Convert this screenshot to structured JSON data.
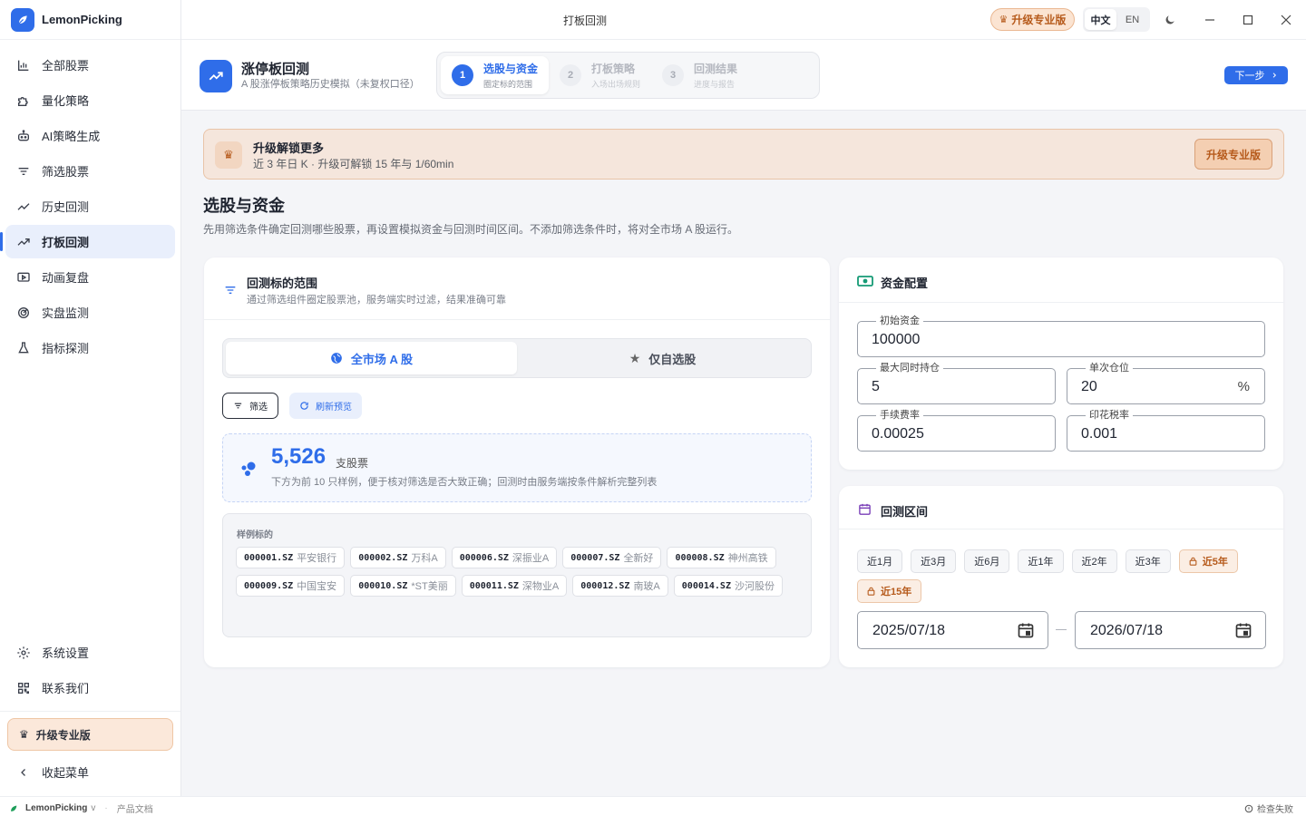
{
  "app": {
    "name": "LemonPicking",
    "window_title": "打板回测"
  },
  "sidebar": {
    "items": [
      {
        "label": "全部股票",
        "icon": "bar-chart-icon"
      },
      {
        "label": "量化策略",
        "icon": "puzzle-icon"
      },
      {
        "label": "AI策略生成",
        "icon": "robot-icon"
      },
      {
        "label": "筛选股票",
        "icon": "filter-icon"
      },
      {
        "label": "历史回测",
        "icon": "trend-icon"
      },
      {
        "label": "打板回测",
        "icon": "trend-up-icon",
        "active": true
      },
      {
        "label": "动画复盘",
        "icon": "play-screen-icon"
      },
      {
        "label": "实盘监测",
        "icon": "radar-icon"
      },
      {
        "label": "指标探测",
        "icon": "flask-icon"
      }
    ],
    "bottom_items": [
      {
        "label": "系统设置",
        "icon": "gear-icon"
      },
      {
        "label": "联系我们",
        "icon": "qr-icon"
      }
    ],
    "upgrade_label": "升级专业版",
    "collapse_label": "收起菜单"
  },
  "topbar": {
    "upgrade_label": "升级专业版",
    "lang_zh": "中文",
    "lang_en": "EN"
  },
  "header": {
    "title": "涨停板回测",
    "subtitle": "A 股涨停板策略历史模拟（未复权口径）",
    "steps": [
      {
        "num": "1",
        "title": "选股与资金",
        "sub": "圈定标的范围",
        "active": true
      },
      {
        "num": "2",
        "title": "打板策略",
        "sub": "入场出场规则",
        "active": false
      },
      {
        "num": "3",
        "title": "回测结果",
        "sub": "进度与报告",
        "active": false
      }
    ],
    "next_label": "下一步"
  },
  "banner": {
    "title": "升级解锁更多",
    "subtitle": "近 3 年日 K · 升级可解锁 15 年与 1/60min",
    "button": "升级专业版"
  },
  "section": {
    "title": "选股与资金",
    "desc": "先用筛选条件确定回测哪些股票，再设置模拟资金与回测时间区间。不添加筛选条件时，将对全市场 A 股运行。"
  },
  "scope": {
    "title": "回测标的范围",
    "subtitle": "通过筛选组件圈定股票池，服务端实时过滤，结果准确可靠",
    "tab_all": "全市场 A 股",
    "tab_watch": "仅自选股",
    "filter_label": "筛选",
    "refresh_label": "刷新预览",
    "count": "5,526",
    "count_unit": "支股票",
    "count_desc": "下方为前 10 只样例，便于核对筛选是否大致正确；回测时由服务端按条件解析完整列表",
    "sample_label": "样例标的",
    "samples": [
      {
        "code": "000001.SZ",
        "name": "平安银行"
      },
      {
        "code": "000002.SZ",
        "name": "万科A"
      },
      {
        "code": "000006.SZ",
        "name": "深振业A"
      },
      {
        "code": "000007.SZ",
        "name": "全新好"
      },
      {
        "code": "000008.SZ",
        "name": "神州高铁"
      },
      {
        "code": "000009.SZ",
        "name": "中国宝安"
      },
      {
        "code": "000010.SZ",
        "name": "*ST美丽"
      },
      {
        "code": "000011.SZ",
        "name": "深物业A"
      },
      {
        "code": "000012.SZ",
        "name": "南玻A"
      },
      {
        "code": "000014.SZ",
        "name": "沙河股份"
      }
    ]
  },
  "capital": {
    "title": "资金配置",
    "initial_label": "初始资金",
    "initial_value": "100000",
    "max_hold_label": "最大同时持仓",
    "max_hold_value": "5",
    "position_label": "单次仓位",
    "position_value": "20",
    "position_suffix": "%",
    "fee_label": "手续费率",
    "fee_value": "0.00025",
    "stamp_label": "印花税率",
    "stamp_value": "0.001"
  },
  "period": {
    "title": "回测区间",
    "presets": [
      {
        "label": "近1月",
        "locked": false
      },
      {
        "label": "近3月",
        "locked": false
      },
      {
        "label": "近6月",
        "locked": false
      },
      {
        "label": "近1年",
        "locked": false
      },
      {
        "label": "近2年",
        "locked": false
      },
      {
        "label": "近3年",
        "locked": false
      },
      {
        "label": "近5年",
        "locked": true
      },
      {
        "label": "近15年",
        "locked": true
      }
    ],
    "start": "2025/07/18",
    "end": "2026/07/18"
  },
  "statusbar": {
    "app": "LemonPicking",
    "version": "v",
    "docs": "产品文档",
    "check": "检查失败"
  },
  "colors": {
    "accent": "#2f6de9",
    "pro": "#b65a1b"
  }
}
